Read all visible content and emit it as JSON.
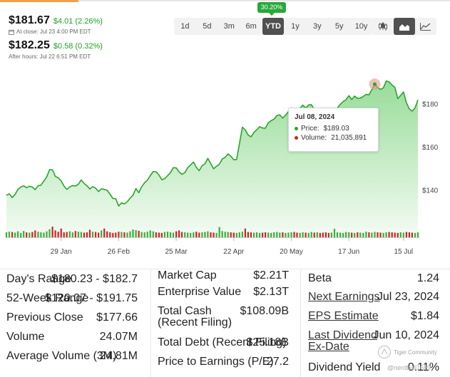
{
  "quote": {
    "price": "$181.67",
    "change": "$4.01 (2.26%)",
    "close_note": "At close: Jul 23 4:00 PM EDT",
    "after_price": "$182.25",
    "after_change": "$0.58 (0.32%)",
    "after_note": "After hours: Jul 22 6:51 PM EDT"
  },
  "range_buttons": [
    "1d",
    "5d",
    "3m",
    "6m",
    "YTD",
    "1y",
    "3y",
    "5y",
    "10y"
  ],
  "active_range": "YTD",
  "ytd_badge": "30.20%",
  "chart_types": [
    "candlestick-icon",
    "area-chart-icon",
    "line-chart-icon"
  ],
  "tooltip": {
    "date": "Jul 08, 2024",
    "price_label": "Price:",
    "price_value": "$189.03",
    "volume_label": "Volume:",
    "volume_value": "21,035,891"
  },
  "colors": {
    "accent_green": "#27a83b",
    "line_green": "#2aa52a",
    "down_red": "#d32222",
    "up_green": "#3aad3a",
    "tooltip_price_dot": "#2aa52a",
    "tooltip_volume_dot": "#d32222"
  },
  "chart_data": {
    "type": "area",
    "title": "",
    "xlabel": "",
    "ylabel": "",
    "x_ticks": [
      "29 Jan",
      "26 Feb",
      "25 Mar",
      "22 Apr",
      "20 May",
      "17 Jun",
      "15 Jul"
    ],
    "y_ticks": [
      140,
      160,
      180
    ],
    "y_tick_labels": [
      "$140",
      "$160",
      "$180"
    ],
    "ylim": [
      118,
      195
    ],
    "grid": false,
    "series": [
      {
        "values": [
          137.5,
          138.2,
          136.4,
          137.9,
          140.2,
          141.3,
          141.9,
          141.0,
          141.7,
          141.3,
          140.1,
          141.9,
          142.2,
          144.1,
          146.0,
          149.4,
          149.3,
          146.3,
          145.6,
          144.2,
          141.8,
          140.2,
          141.4,
          142.0,
          141.8,
          142.6,
          144.6,
          143.0,
          141.9,
          140.4,
          141.5,
          140.8,
          139.2,
          140.5,
          140.2,
          139.8,
          138.0,
          136.0,
          135.9,
          132.5,
          134.0,
          133.5,
          134.5,
          136.2,
          137.5,
          140.6,
          138.7,
          141.4,
          143.3,
          144.5,
          146.6,
          148.5,
          148.4,
          146.9,
          144.7,
          145.2,
          146.6,
          148.0,
          150.3,
          150.2,
          148.3,
          147.2,
          148.0,
          150.3,
          151.6,
          152.9,
          150.5,
          148.9,
          151.2,
          152.1,
          154.6,
          152.2,
          149.8,
          150.9,
          151.9,
          154.3,
          155.1,
          156.7,
          155.6,
          154.0,
          154.1,
          161.5,
          169.1,
          167.8,
          165.5,
          164.6,
          166.6,
          167.9,
          169.3,
          168.7,
          168.6,
          171.1,
          172.1,
          172.8,
          174.5,
          174.8,
          173.3,
          174.6,
          176.3,
          178.0,
          177.2,
          176.2,
          177.9,
          179.3,
          178.0,
          179.4,
          179.5,
          177.3,
          177.4,
          176.5,
          174.5,
          174.4,
          172.5,
          174.6,
          176.1,
          177.9,
          179.7,
          180.9,
          181.8,
          183.7,
          181.9,
          183.5,
          182.4,
          182.6,
          183.3,
          184.3,
          184.1,
          186.5,
          189.0,
          187.5,
          186.6,
          187.3,
          190.5,
          190.1,
          188.6,
          187.6,
          182.3,
          183.8,
          185.4,
          180.4,
          177.6,
          176.5,
          178.0,
          181.7
        ],
        "volume": [
          16,
          18,
          17,
          15,
          19,
          14,
          20,
          16,
          15,
          17,
          22,
          18,
          16,
          15,
          19,
          26,
          34,
          22,
          18,
          28,
          16,
          17,
          19,
          16,
          20,
          18,
          17,
          15,
          16,
          24,
          18,
          17,
          15,
          22,
          28,
          19,
          16,
          14,
          15,
          18,
          17,
          16,
          15,
          19,
          25,
          23,
          21,
          17,
          16,
          18,
          22,
          19,
          16,
          15,
          14,
          17,
          18,
          16,
          15,
          19,
          22,
          17,
          16,
          15,
          14,
          16,
          18,
          15,
          16,
          17,
          19,
          16,
          15,
          14,
          33,
          20,
          18,
          17,
          16,
          15,
          14,
          16,
          18,
          28,
          17,
          16,
          15,
          16,
          14,
          15,
          16,
          15,
          14,
          16,
          17,
          15,
          16,
          14,
          15,
          16,
          17,
          15,
          14,
          16,
          15,
          14,
          17,
          15,
          16,
          14,
          15,
          16,
          14,
          15,
          27,
          16,
          15,
          14,
          17,
          16,
          15,
          14,
          16,
          15,
          14,
          18,
          16,
          15,
          17,
          16,
          15,
          14,
          16,
          17,
          16,
          15,
          14,
          16,
          15,
          17,
          16,
          15,
          14,
          16
        ]
      }
    ]
  },
  "stats": {
    "col1": [
      {
        "label": "Day's Range",
        "value": "$180.23 - $182.7"
      },
      {
        "label": "52-Week Range",
        "value": "$120.07 - $191.75"
      },
      {
        "label": "Previous Close",
        "value": "$177.66"
      },
      {
        "label": "Volume",
        "value": "24.07M"
      },
      {
        "label": "Average Volume (3M)",
        "value": "24.81M"
      }
    ],
    "col2": [
      {
        "label": "Market Cap",
        "value": "$2.21T"
      },
      {
        "label": "Enterprise Value",
        "value": "$2.13T"
      },
      {
        "label": "Total Cash (Recent Filing)",
        "value": "$108.09B"
      },
      {
        "label": "Total Debt (Recent Filing)",
        "value": "$25.18B"
      },
      {
        "label": "Price to Earnings (P/E)",
        "value": "27.2"
      }
    ],
    "col3": [
      {
        "label": "Beta",
        "value": "1.24"
      },
      {
        "label": "Next Earnings",
        "value": "Jul 23, 2024"
      },
      {
        "label": "EPS Estimate",
        "value": "$1.84"
      },
      {
        "label": "Last Dividend Ex-Date",
        "value": "Jun 10, 2024"
      },
      {
        "label": "Dividend Yield",
        "value": "0.11%"
      }
    ]
  },
  "watermark": {
    "brand": "Tiger Community",
    "handle": "@nerdbull1669"
  }
}
